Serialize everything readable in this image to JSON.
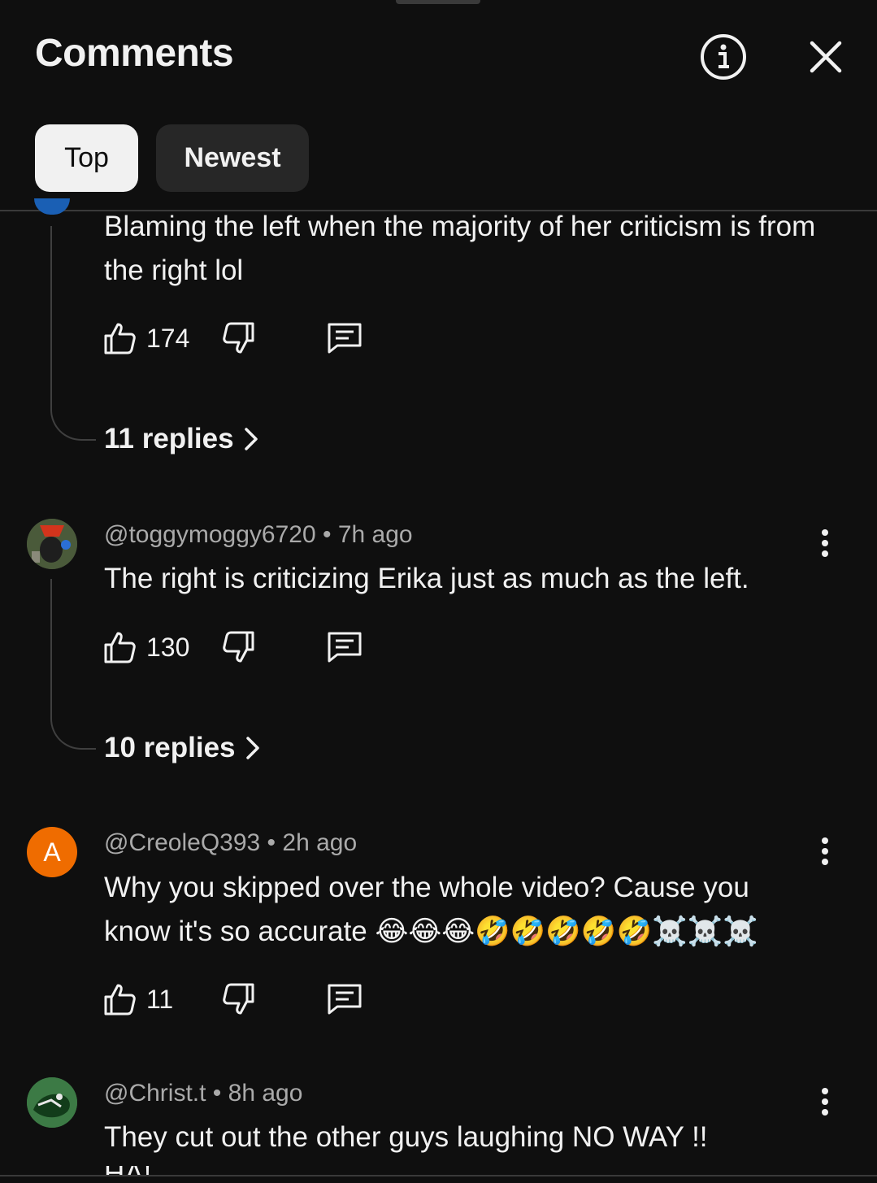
{
  "header": {
    "title": "Comments"
  },
  "tabs": [
    {
      "label": "Top"
    },
    {
      "label": "Newest"
    }
  ],
  "comments": [
    {
      "text": "Blaming the left when the majority of her criticism is from the right lol",
      "likes": "174",
      "replies": "11 replies"
    },
    {
      "author": "@toggymoggy6720",
      "time": "7h ago",
      "text": "The right is criticizing Erika just as much as the left.",
      "likes": "130",
      "replies": "10 replies"
    },
    {
      "author": "@CreoleQ393",
      "time": "2h ago",
      "avatar_letter": "A",
      "text_line1": "Why you skipped over the whole video? Cause you",
      "text_line2": "know it's so accurate 😂😂😂🤣🤣🤣🤣🤣☠️☠️☠️",
      "likes": "11"
    },
    {
      "author": "@Christ.t",
      "time": "8h ago",
      "text": "They cut out the other guys laughing NO WAY !!",
      "text_cut": "HA!"
    }
  ],
  "meta_separator": " • ",
  "icons": {
    "info": "info-icon",
    "close": "close-icon",
    "like": "thumbs-up-icon",
    "dislike": "thumbs-down-icon",
    "reply": "comment-icon",
    "more": "more-vert-icon",
    "chevron": "chevron-right-icon"
  },
  "colors": {
    "background": "#0f0f0f",
    "text": "#f1f1f1",
    "secondary": "#aaaaaa",
    "avatar_orange": "#ef6c00"
  }
}
